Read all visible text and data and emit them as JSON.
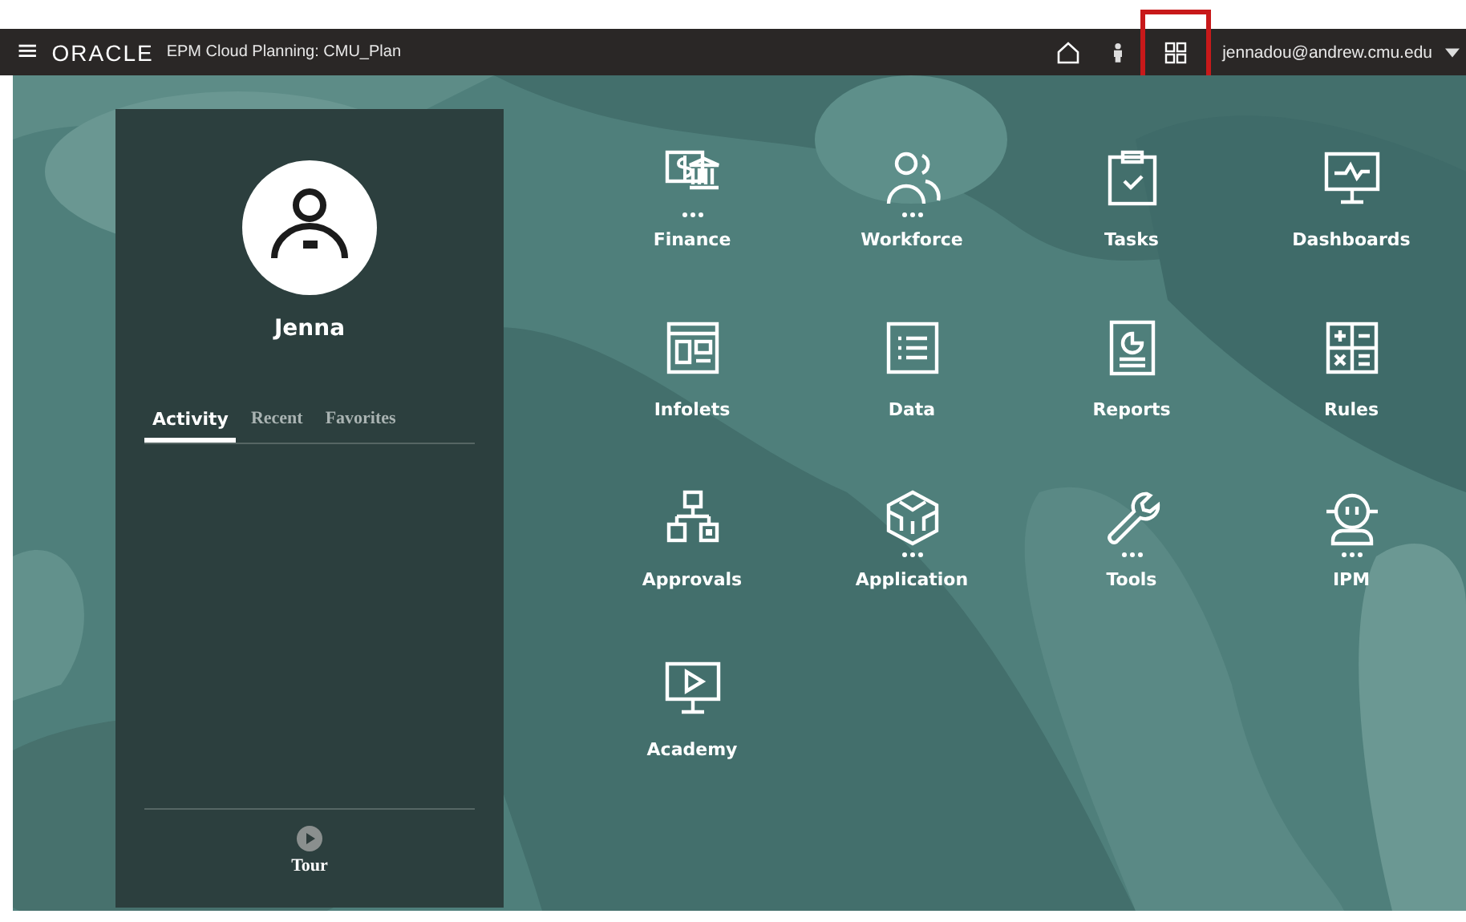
{
  "header": {
    "menu_glyph": "≡",
    "brand": "ORACLE",
    "app_title": "EPM Cloud Planning: CMU_Plan",
    "user": "jennadou@andrew.cmu.edu"
  },
  "profile": {
    "name": "Jenna",
    "tabs": [
      {
        "label": "Activity",
        "selected": true
      },
      {
        "label": "Recent",
        "selected": false
      },
      {
        "label": "Favorites",
        "selected": false
      }
    ],
    "tour": "Tour"
  },
  "cards": [
    {
      "label": "Finance",
      "kind": "finance",
      "more": true
    },
    {
      "label": "Workforce",
      "kind": "workforce",
      "more": true
    },
    {
      "label": "Tasks",
      "kind": "tasks",
      "more": false
    },
    {
      "label": "Dashboards",
      "kind": "dashboards",
      "more": false
    },
    {
      "label": "Infolets",
      "kind": "infolets",
      "more": false
    },
    {
      "label": "Data",
      "kind": "data",
      "more": false
    },
    {
      "label": "Reports",
      "kind": "reports",
      "more": false
    },
    {
      "label": "Rules",
      "kind": "rules",
      "more": false
    },
    {
      "label": "Approvals",
      "kind": "approvals",
      "more": false
    },
    {
      "label": "Application",
      "kind": "application",
      "more": true
    },
    {
      "label": "Tools",
      "kind": "tools",
      "more": true
    },
    {
      "label": "IPM",
      "kind": "ipm",
      "more": true
    },
    {
      "label": "Academy",
      "kind": "academy",
      "more": false
    }
  ]
}
